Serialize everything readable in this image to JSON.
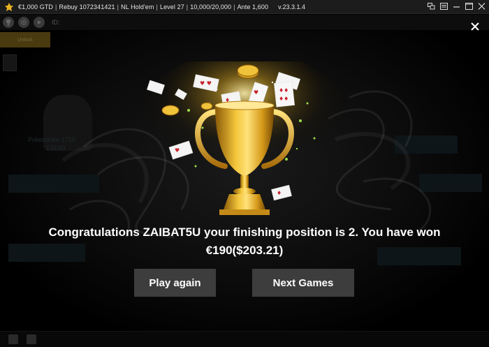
{
  "window": {
    "title_parts": [
      "€1,000 GTD",
      "Rebuy 1072341421",
      "NL Hold'em",
      "Level 27",
      "10,000/20,000",
      "Ante 1,600"
    ],
    "version": "v.23.3.1.4",
    "icons": [
      "app-logo-icon",
      "restore-windows-icon",
      "list-icon",
      "minimize-icon",
      "maximize-icon",
      "close-icon"
    ]
  },
  "toolbar": {
    "id_label": "ID:",
    "icons": [
      "trophy-icon",
      "gear-icon",
      "play-icon"
    ]
  },
  "unlock_tab": {
    "label": "Unlock"
  },
  "background_player": {
    "name": "Pokerstrike 1719",
    "chips": "133.69"
  },
  "popup": {
    "close_icon": "close-icon",
    "message_line1": "Congratulations ZAIBAT5U your finishing position is 2. You have won",
    "message_line2": "€190($203.21)",
    "play_again_label": "Play again",
    "next_games_label": "Next Games"
  },
  "colors": {
    "accent_gold": "#e8b323",
    "button_bg": "#3d3d3d",
    "background": "#000000"
  }
}
